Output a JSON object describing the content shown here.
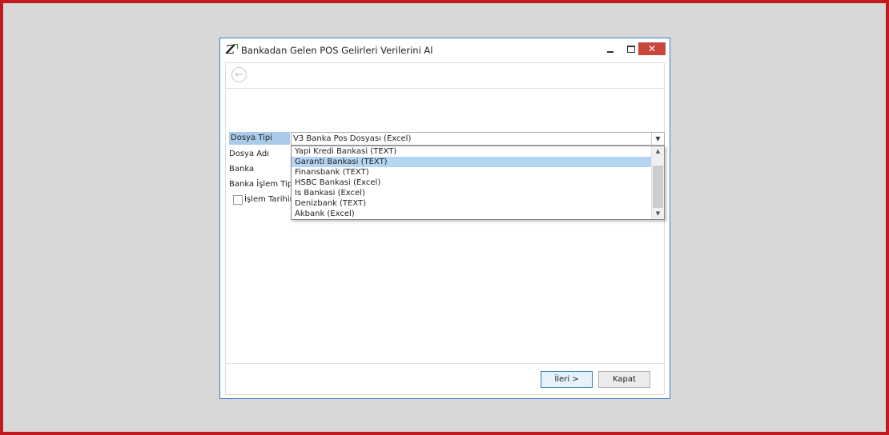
{
  "window": {
    "title": "Bankadan Gelen POS Gelirleri Verilerini Al",
    "close_glyph": "✕",
    "back_glyph": "←"
  },
  "form": {
    "dosya_tipi_label": "Dosya Tipi",
    "dosya_tipi_value": "V3 Banka Pos Dosyası (Excel)",
    "dosya_adi_label": "Dosya Adı",
    "banka_label": "Banka",
    "banka_islem_tipi_label": "Banka İşlem Tipi",
    "islem_tarihi_label": "İşlem Tarihin"
  },
  "dropdown": {
    "items": [
      "Yapi Kredi Bankasi (TEXT)",
      "Garanti Bankasi (TEXT)",
      "Finansbank (TEXT)",
      "HSBC Bankasi (Excel)",
      "Is Bankasi (Excel)",
      "Denizbank (TEXT)",
      "Akbank (Excel)"
    ],
    "selected_index": 1
  },
  "buttons": {
    "next": "İleri >",
    "close": "Kapat"
  },
  "colors": {
    "frame_border": "#c0191e",
    "window_border": "#3a7fc4",
    "close_button": "#c9463d",
    "label_highlight": "#a9cbe9",
    "selected_item": "#b5d6f2"
  },
  "icons": {
    "app": "z-logo-icon",
    "back": "arrow-left-circle-icon",
    "minimize": "minimize-icon",
    "maximize": "maximize-icon",
    "close": "close-icon",
    "combo": "chevron-down-icon"
  }
}
